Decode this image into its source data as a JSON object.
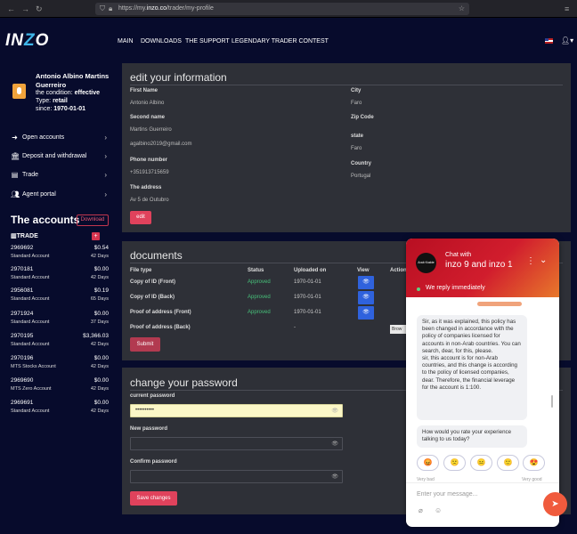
{
  "browser": {
    "url_prefix": "https://my.",
    "url_domain": "inzo.co",
    "url_path": "/trader/my-profile"
  },
  "header": {
    "logo": "INZO",
    "nav": [
      "MAIN",
      "DOWNLOADS",
      "THE SUPPORT",
      "LEGENDARY TRADER CONTEST"
    ]
  },
  "profile": {
    "name": "Antonio Albino Martins Guerreiro",
    "condition_label": "the condition:",
    "condition_value": "effective",
    "type_label": "Type:",
    "type_value": "retail",
    "since_label": "since:",
    "since_value": "1970-01-01"
  },
  "sidebar_menu": [
    {
      "label": "Open accounts",
      "icon": "arrow-circle-icon"
    },
    {
      "label": "Deposit and withdrawal",
      "icon": "bank-icon"
    },
    {
      "label": "Trade",
      "icon": "document-icon"
    },
    {
      "label": "Agent portal",
      "icon": "users-icon"
    }
  ],
  "accounts": {
    "title": "The accounts",
    "download_label": "Download",
    "group_label": "TRADE",
    "add_label": "+",
    "items": [
      {
        "number": "2969692",
        "balance": "$0.54",
        "type": "Standard Account",
        "age": "42 Days"
      },
      {
        "number": "2970181",
        "balance": "$0.00",
        "type": "Standard Account",
        "age": "42 Days"
      },
      {
        "number": "2956081",
        "balance": "$0.19",
        "type": "Standard Account",
        "age": "65 Days"
      },
      {
        "number": "2971924",
        "balance": "$0.00",
        "type": "Standard Account",
        "age": "37 Days"
      },
      {
        "number": "2970195",
        "balance": "$3,366.03",
        "type": "Standard Account",
        "age": "42 Days"
      },
      {
        "number": "2970196",
        "balance": "$0.00",
        "type": "MTS Stocks Account",
        "age": "42 Days"
      },
      {
        "number": "2969690",
        "balance": "$0.00",
        "type": "MTS Zero Account",
        "age": "42 Days"
      },
      {
        "number": "2969691",
        "balance": "$0.00",
        "type": "Standard Account",
        "age": "42 Days"
      }
    ]
  },
  "edit_info": {
    "title": "edit your information",
    "first_name_label": "First Name",
    "first_name": "Antonio Albino",
    "second_name_label": "Second name",
    "second_name": "Martins Guerreiro",
    "email": "agalbino2019@gmail.com",
    "phone_label": "Phone number",
    "phone": "+351913715659",
    "address_label": "The address",
    "address": "Av 5 de Outubro",
    "city_label": "City",
    "city": "Faro",
    "zip_label": "Zip Code",
    "state_label": "state",
    "state": "Faro",
    "country_label": "Country",
    "country": "Portugal",
    "edit_button": "edit"
  },
  "documents": {
    "title": "documents",
    "headers": [
      "File type",
      "Status",
      "Uploaded on",
      "View",
      "Action"
    ],
    "rows": [
      {
        "type": "Copy of ID (Front)",
        "status": "Approved",
        "uploaded": "1970-01-01"
      },
      {
        "type": "Copy of ID (Back)",
        "status": "Approved",
        "uploaded": "1970-01-01"
      },
      {
        "type": "Proof of address (Front)",
        "status": "Approved",
        "uploaded": "1970-01-01"
      },
      {
        "type": "Proof of address (Back)",
        "status": "",
        "uploaded": "-"
      }
    ],
    "submit_button": "Submit",
    "browse_tooltip": "Brow"
  },
  "password": {
    "title": "change your password",
    "current_label": "current password",
    "current_value": "••••••••••",
    "new_label": "New password",
    "confirm_label": "Confirm password",
    "save_button": "Save changes"
  },
  "chat": {
    "avatar_text": "Arab Krakte",
    "with_label": "Chat with",
    "agent_name": "inzo 9 and inzo 1",
    "status": "We reply immediately",
    "message": "Sir, as it was explained, this policy has been changed in accordance with the policy of companies licensed for accounts in non-Arab countries. You can search, dear, for this, please.\nsir, this account is for non-Arab countries, and this change is according to the policy of licensed companies, dear. Therefore, the financial leverage for the account is 1:100.",
    "rating_question": "How would you rate your experience talking to us today?",
    "rating_emojis": [
      "😡",
      "🙁",
      "😐",
      "🙂",
      "😍"
    ],
    "rating_low": "Very bad",
    "rating_high": "Very good",
    "input_placeholder": "Enter your message..."
  }
}
